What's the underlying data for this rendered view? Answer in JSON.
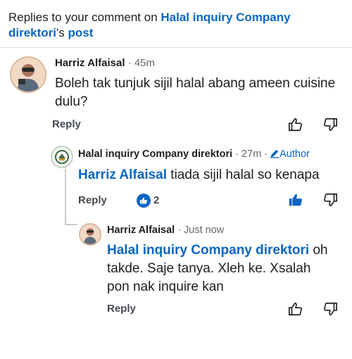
{
  "header": {
    "prefix": "Replies to your comment on ",
    "page_name_1": "Halal inquiry Company",
    "page_name_2": "direktori",
    "suffix_possessive": "'s ",
    "post_word": "post"
  },
  "comments": [
    {
      "author": "Harriz Alfaisal",
      "time": "· 45m",
      "text": "Boleh tak tunjuk sijil halal abang ameen cuisine dulu?",
      "reply_label": "Reply"
    },
    {
      "author": "Halal inquiry Company direktori",
      "time": "· 27m ·",
      "author_badge": "Author",
      "mention": "Harriz Alfaisal",
      "text": " tiada sijil halal so kenapa",
      "reply_label": "Reply",
      "like_count": "2"
    },
    {
      "author": "Harriz Alfaisal",
      "time": "· Just now",
      "mention": "Halal inquiry Company direktori",
      "text": " oh takde. Saje tanya. Xleh ke. Xsalah pon nak inquire kan",
      "reply_label": "Reply"
    }
  ],
  "colors": {
    "accent": "#0a66c2",
    "text": "#1c1e21",
    "muted": "#65676b"
  }
}
